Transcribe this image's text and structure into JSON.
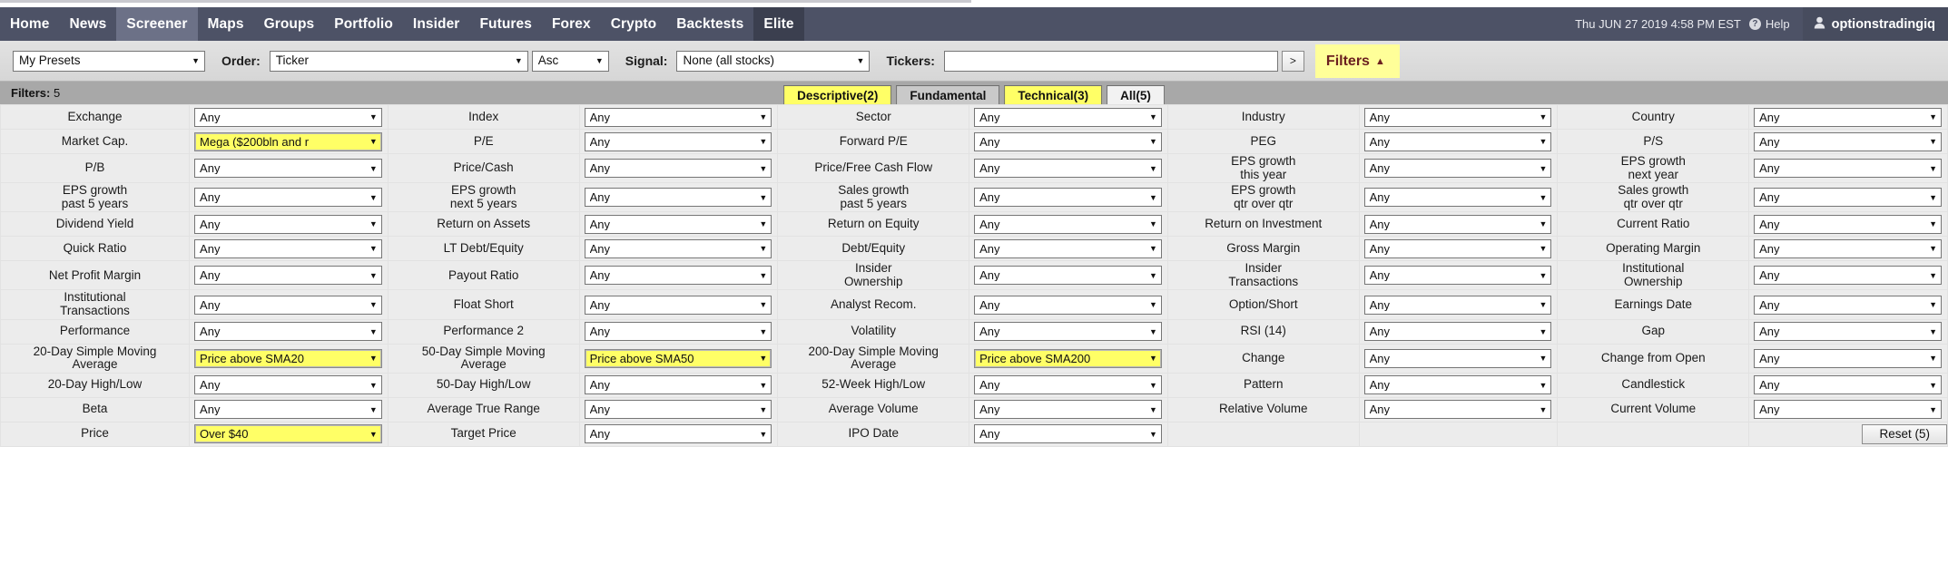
{
  "nav": {
    "items": [
      {
        "label": "Home",
        "state": "normal"
      },
      {
        "label": "News",
        "state": "normal"
      },
      {
        "label": "Screener",
        "state": "active-light"
      },
      {
        "label": "Maps",
        "state": "normal"
      },
      {
        "label": "Groups",
        "state": "normal"
      },
      {
        "label": "Portfolio",
        "state": "normal"
      },
      {
        "label": "Insider",
        "state": "normal"
      },
      {
        "label": "Futures",
        "state": "normal"
      },
      {
        "label": "Forex",
        "state": "normal"
      },
      {
        "label": "Crypto",
        "state": "normal"
      },
      {
        "label": "Backtests",
        "state": "normal"
      },
      {
        "label": "Elite",
        "state": "active-dark"
      }
    ],
    "datetime": "Thu JUN 27 2019 4:58 PM EST",
    "help_label": "Help",
    "help_icon": "question-circle-icon",
    "user_name": "optionstradingiq",
    "user_icon": "person-icon",
    "bg_color": "#4d5266"
  },
  "toolbar": {
    "presets_value": "My Presets",
    "order_label": "Order:",
    "order_value": "Ticker",
    "direction_value": "Asc",
    "signal_label": "Signal:",
    "signal_value": "None (all stocks)",
    "tickers_label": "Tickers:",
    "tickers_value": "",
    "tickers_placeholder": "",
    "go_label": ">",
    "filters_label": "Filters",
    "filters_caret": "▲",
    "filters_bg": "#ffff99",
    "filters_fg": "#6b2020"
  },
  "filters_bar": {
    "label": "Filters:",
    "count": "5",
    "tabs": [
      {
        "label": "Descriptive(2)",
        "style": "yellow"
      },
      {
        "label": "Fundamental",
        "style": "grey"
      },
      {
        "label": "Technical(3)",
        "style": "yellow"
      },
      {
        "label": "All(5)",
        "style": "white"
      }
    ]
  },
  "grid": {
    "rows": [
      [
        {
          "label": "Exchange",
          "value": "Any",
          "hl": false
        },
        {
          "label": "Index",
          "value": "Any",
          "hl": false
        },
        {
          "label": "Sector",
          "value": "Any",
          "hl": false
        },
        {
          "label": "Industry",
          "value": "Any",
          "hl": false
        },
        {
          "label": "Country",
          "value": "Any",
          "hl": false
        }
      ],
      [
        {
          "label": "Market Cap.",
          "value": "Mega ($200bln and r",
          "hl": true
        },
        {
          "label": "P/E",
          "value": "Any",
          "hl": false
        },
        {
          "label": "Forward P/E",
          "value": "Any",
          "hl": false
        },
        {
          "label": "PEG",
          "value": "Any",
          "hl": false
        },
        {
          "label": "P/S",
          "value": "Any",
          "hl": false
        }
      ],
      [
        {
          "label": "P/B",
          "value": "Any",
          "hl": false
        },
        {
          "label": "Price/Cash",
          "value": "Any",
          "hl": false
        },
        {
          "label": "Price/Free Cash Flow",
          "value": "Any",
          "hl": false
        },
        {
          "label": "EPS growth\nthis year",
          "value": "Any",
          "hl": false
        },
        {
          "label": "EPS growth\nnext year",
          "value": "Any",
          "hl": false
        }
      ],
      [
        {
          "label": "EPS growth\npast 5 years",
          "value": "Any",
          "hl": false
        },
        {
          "label": "EPS growth\nnext 5 years",
          "value": "Any",
          "hl": false
        },
        {
          "label": "Sales growth\npast 5 years",
          "value": "Any",
          "hl": false
        },
        {
          "label": "EPS growth\nqtr over qtr",
          "value": "Any",
          "hl": false
        },
        {
          "label": "Sales growth\nqtr over qtr",
          "value": "Any",
          "hl": false
        }
      ],
      [
        {
          "label": "Dividend Yield",
          "value": "Any",
          "hl": false
        },
        {
          "label": "Return on Assets",
          "value": "Any",
          "hl": false
        },
        {
          "label": "Return on Equity",
          "value": "Any",
          "hl": false
        },
        {
          "label": "Return on Investment",
          "value": "Any",
          "hl": false
        },
        {
          "label": "Current Ratio",
          "value": "Any",
          "hl": false
        }
      ],
      [
        {
          "label": "Quick Ratio",
          "value": "Any",
          "hl": false
        },
        {
          "label": "LT Debt/Equity",
          "value": "Any",
          "hl": false
        },
        {
          "label": "Debt/Equity",
          "value": "Any",
          "hl": false
        },
        {
          "label": "Gross Margin",
          "value": "Any",
          "hl": false
        },
        {
          "label": "Operating Margin",
          "value": "Any",
          "hl": false
        }
      ],
      [
        {
          "label": "Net Profit Margin",
          "value": "Any",
          "hl": false
        },
        {
          "label": "Payout Ratio",
          "value": "Any",
          "hl": false
        },
        {
          "label": "Insider\nOwnership",
          "value": "Any",
          "hl": false
        },
        {
          "label": "Insider\nTransactions",
          "value": "Any",
          "hl": false
        },
        {
          "label": "Institutional\nOwnership",
          "value": "Any",
          "hl": false
        }
      ],
      [
        {
          "label": "Institutional\nTransactions",
          "value": "Any",
          "hl": false
        },
        {
          "label": "Float Short",
          "value": "Any",
          "hl": false
        },
        {
          "label": "Analyst Recom.",
          "value": "Any",
          "hl": false
        },
        {
          "label": "Option/Short",
          "value": "Any",
          "hl": false
        },
        {
          "label": "Earnings Date",
          "value": "Any",
          "hl": false
        }
      ],
      [
        {
          "label": "Performance",
          "value": "Any",
          "hl": false
        },
        {
          "label": "Performance 2",
          "value": "Any",
          "hl": false
        },
        {
          "label": "Volatility",
          "value": "Any",
          "hl": false
        },
        {
          "label": "RSI (14)",
          "value": "Any",
          "hl": false
        },
        {
          "label": "Gap",
          "value": "Any",
          "hl": false
        }
      ],
      [
        {
          "label": "20-Day Simple Moving\nAverage",
          "value": "Price above SMA20",
          "hl": true
        },
        {
          "label": "50-Day Simple Moving\nAverage",
          "value": "Price above SMA50",
          "hl": true
        },
        {
          "label": "200-Day Simple Moving\nAverage",
          "value": "Price above SMA200",
          "hl": true
        },
        {
          "label": "Change",
          "value": "Any",
          "hl": false
        },
        {
          "label": "Change from Open",
          "value": "Any",
          "hl": false
        }
      ],
      [
        {
          "label": "20-Day High/Low",
          "value": "Any",
          "hl": false
        },
        {
          "label": "50-Day High/Low",
          "value": "Any",
          "hl": false
        },
        {
          "label": "52-Week High/Low",
          "value": "Any",
          "hl": false
        },
        {
          "label": "Pattern",
          "value": "Any",
          "hl": false
        },
        {
          "label": "Candlestick",
          "value": "Any",
          "hl": false
        }
      ],
      [
        {
          "label": "Beta",
          "value": "Any",
          "hl": false
        },
        {
          "label": "Average True Range",
          "value": "Any",
          "hl": false
        },
        {
          "label": "Average Volume",
          "value": "Any",
          "hl": false
        },
        {
          "label": "Relative Volume",
          "value": "Any",
          "hl": false
        },
        {
          "label": "Current Volume",
          "value": "Any",
          "hl": false
        }
      ],
      [
        {
          "label": "Price",
          "value": "Over $40",
          "hl": true
        },
        {
          "label": "Target Price",
          "value": "Any",
          "hl": false
        },
        {
          "label": "IPO Date",
          "value": "Any",
          "hl": false
        },
        {
          "label": "",
          "value": "",
          "hl": false,
          "empty": true
        },
        {
          "label": "",
          "value": "",
          "hl": false,
          "reset": true
        }
      ]
    ],
    "reset_label": "Reset (5)",
    "caret_glyph": "▼"
  }
}
